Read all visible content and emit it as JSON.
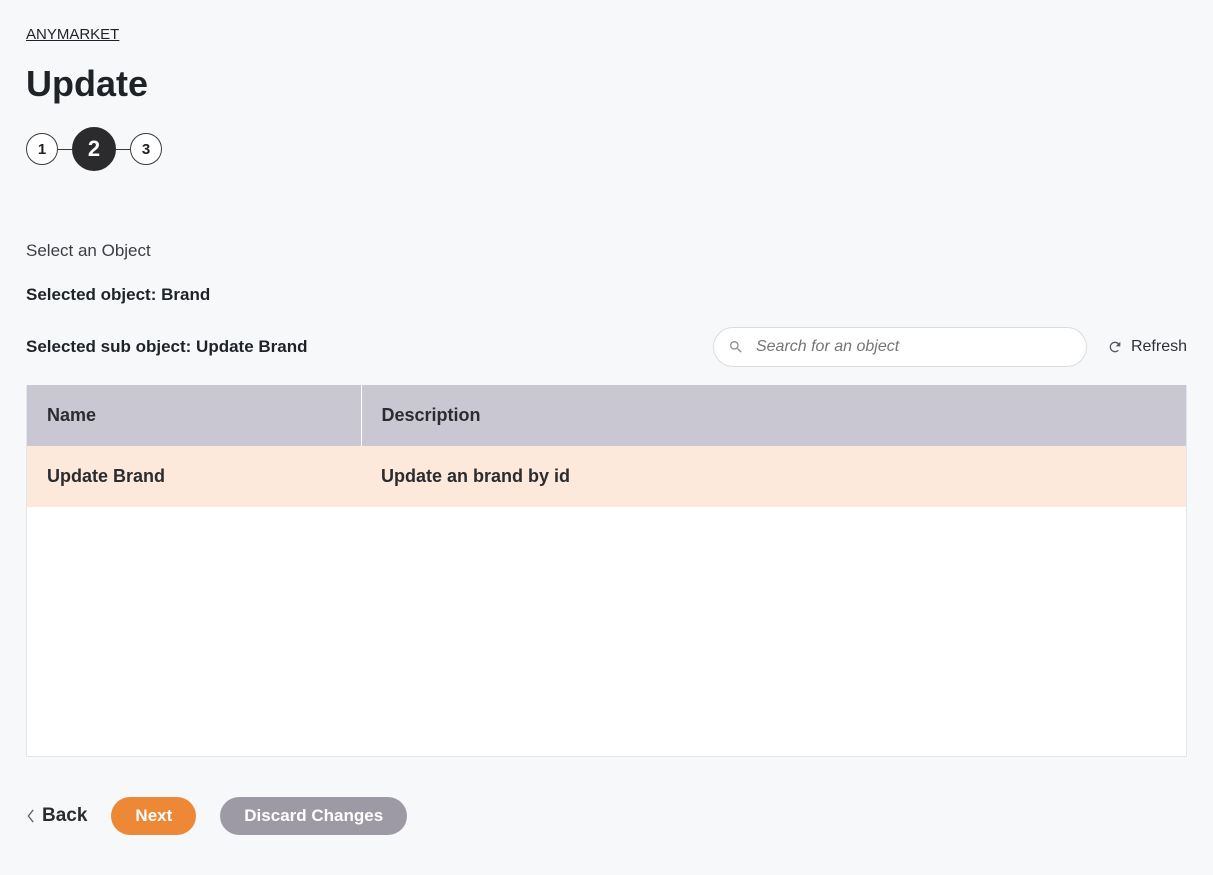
{
  "breadcrumb": {
    "label": "ANYMARKET"
  },
  "page_title": "Update",
  "stepper": {
    "steps": [
      {
        "label": "1",
        "active": false
      },
      {
        "label": "2",
        "active": true
      },
      {
        "label": "3",
        "active": false
      }
    ]
  },
  "section_label": "Select an Object",
  "selected_object_line": "Selected object: Brand",
  "selected_sub_object_line": "Selected sub object: Update Brand",
  "search": {
    "placeholder": "Search for an object"
  },
  "refresh_label": "Refresh",
  "table": {
    "columns": {
      "name": "Name",
      "description": "Description"
    },
    "rows": [
      {
        "name": "Update Brand",
        "description": "Update an brand by id",
        "selected": true
      }
    ]
  },
  "footer": {
    "back_label": "Back",
    "next_label": "Next",
    "discard_label": "Discard Changes"
  }
}
